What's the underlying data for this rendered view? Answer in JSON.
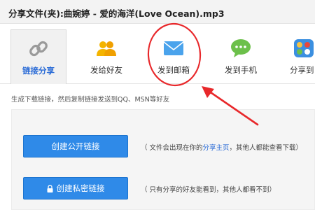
{
  "window": {
    "title": "分享文件(夹):曲婉婷 - 爱的海洋(Love Ocean).mp3"
  },
  "tabs": [
    {
      "label": "链接分享",
      "icon": "link-icon",
      "active": true
    },
    {
      "label": "发给好友",
      "icon": "friends-icon",
      "active": false
    },
    {
      "label": "发到邮箱",
      "icon": "mail-icon",
      "active": false
    },
    {
      "label": "发到手机",
      "icon": "chat-bubble-icon",
      "active": false
    },
    {
      "label": "分享到",
      "icon": "apps-icon",
      "active": false
    }
  ],
  "hint": "生成下载链接，然后复制链接发送到QQ、MSN等好友",
  "public_link": {
    "button_label": "创建公开链接",
    "desc_prefix": "（ 文件会出现在你的",
    "desc_link": "分享主页",
    "desc_suffix": "，其他人都能查看下载）"
  },
  "private_link": {
    "button_label": "创建私密链接",
    "button_icon": "lock-icon",
    "desc": "（ 只有分享的好友能看到，其他人都看不到）"
  },
  "colors": {
    "accent_blue": "#2f8ae8",
    "annotation_red": "#e8282b",
    "link_green": "#6cc04a",
    "friends_yellow": "#f4b400"
  }
}
